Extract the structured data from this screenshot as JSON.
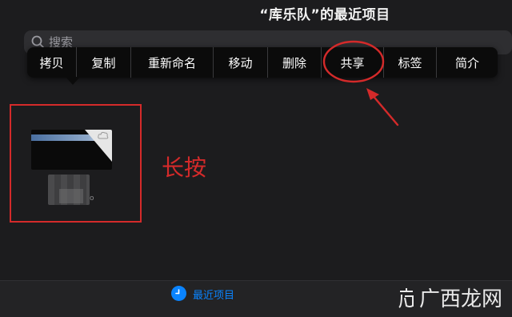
{
  "header": {
    "title": "“库乐队”的最近项目"
  },
  "search": {
    "placeholder": "搜索",
    "icon": "search-icon"
  },
  "context_menu": {
    "items": [
      {
        "label": "拷贝"
      },
      {
        "label": "复制"
      },
      {
        "label": "重新命名"
      },
      {
        "label": "移动"
      },
      {
        "label": "删除"
      },
      {
        "label": "共享"
      },
      {
        "label": "标签"
      },
      {
        "label": "简介"
      }
    ]
  },
  "annotation": {
    "long_press_label": "长按",
    "color": "#d42a2a"
  },
  "tab_bar": {
    "recent_label": "最近项目",
    "recent_icon": "clock-icon",
    "accent": "#0a84ff"
  },
  "watermark": {
    "text": "广西龙网"
  }
}
